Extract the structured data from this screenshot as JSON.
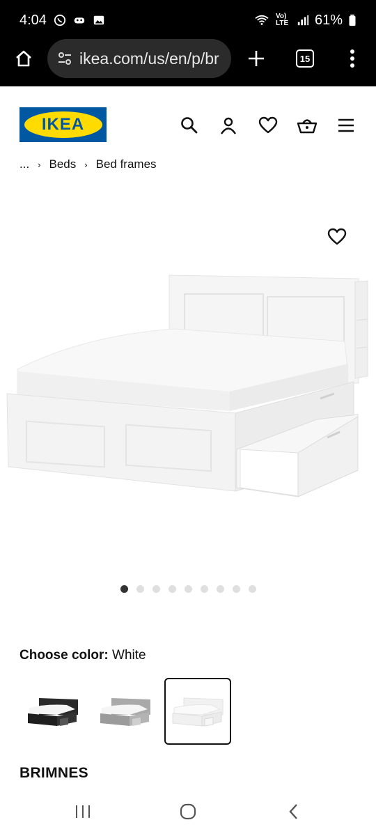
{
  "status_bar": {
    "time": "4:04",
    "network": "Vo) LTE",
    "battery": "61%"
  },
  "browser": {
    "url": "ikea.com/us/en/p/br",
    "tab_count": "15"
  },
  "site": {
    "logo_text": "IKEA",
    "brand_colors": {
      "blue": "#0058a3",
      "yellow": "#ffdb00"
    }
  },
  "breadcrumb": [
    "...",
    "Beds",
    "Bed frames"
  ],
  "gallery": {
    "total_images": 9,
    "active_index": 0
  },
  "product": {
    "choose_color_label": "Choose color:",
    "selected_color": "White",
    "swatches": [
      "black-brown",
      "gray",
      "white"
    ],
    "selected_swatch": "white",
    "name": "BRIMNES"
  },
  "icons": {
    "header": [
      "search-icon",
      "account-icon",
      "heart-icon",
      "basket-icon",
      "menu-icon"
    ]
  }
}
